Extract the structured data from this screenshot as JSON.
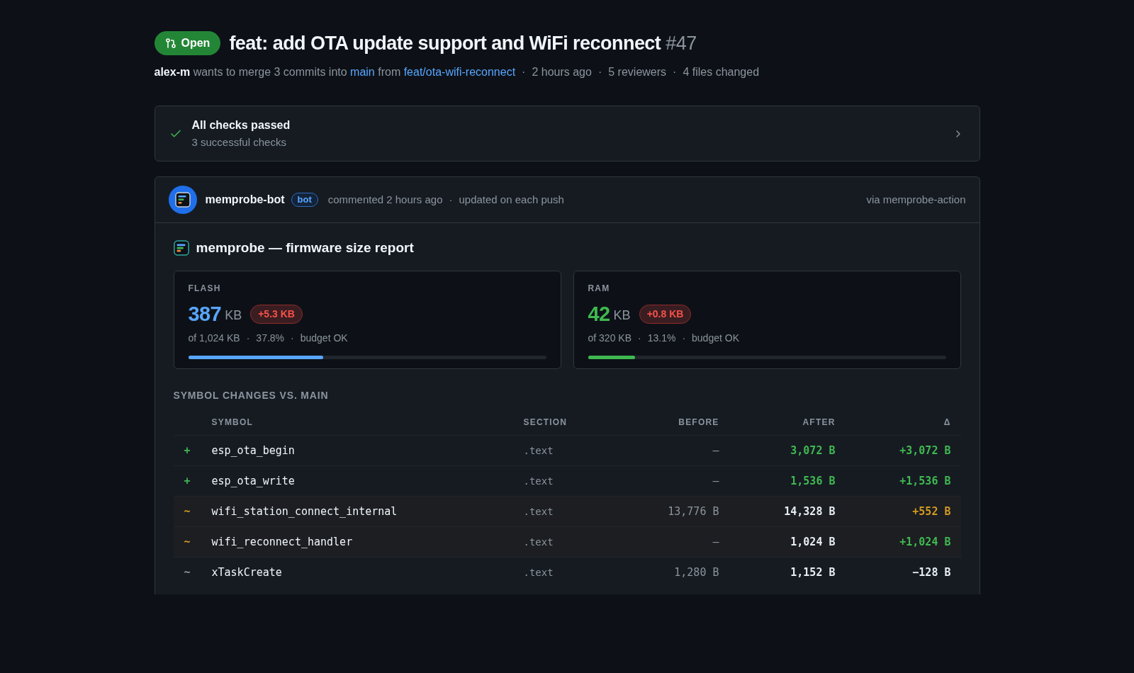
{
  "pull_request": {
    "state": {
      "label": "Open",
      "kind": "open"
    },
    "title": "feat: add OTA update support and WiFi reconnect",
    "number": "#47"
  },
  "summary": {
    "author": "alex-m",
    "action": "wants to merge 3 commits into",
    "base_branch": "main",
    "joiner": "from",
    "head_branch": "feat/ota-wifi-reconnect",
    "separator": "·",
    "meta": [
      "2 hours ago",
      "5 reviewers",
      "4 files changed"
    ]
  },
  "checks": {
    "passed": true,
    "title": "All checks passed",
    "subtitle": "3 successful checks"
  },
  "comment": {
    "author": "memprobe-bot",
    "badge": "bot",
    "action": "commented 2 hours ago",
    "separator": "·",
    "note": "updated on each push",
    "source": "via memprobe-action",
    "report": {
      "title": "memprobe — firmware size report",
      "cards": [
        {
          "label": "FLASH",
          "value": "387",
          "unit": "KB",
          "delta": "+5.3 KB",
          "separator": "·",
          "details": [
            "of 1,024 KB",
            "37.8%",
            "budget OK"
          ],
          "level": 0.378,
          "color": "#58a6ff"
        },
        {
          "label": "RAM",
          "value": "42",
          "unit": "KB",
          "delta": "+0.8 KB",
          "separator": "·",
          "details": [
            "of 320 KB",
            "13.1%",
            "budget OK"
          ],
          "level": 0.131,
          "color": "#3fb950"
        }
      ],
      "symbols": {
        "title": "SYMBOL CHANGES VS. MAIN",
        "columns": [
          "SYMBOL",
          "SECTION",
          "BEFORE",
          "AFTER",
          "Δ"
        ],
        "rows": [
          {
            "marker": "+",
            "kind": "added",
            "symbol": "esp_ota_begin",
            "section": ".text",
            "before": "—",
            "after": {
              "text": "3,072 B",
              "kind": "positive"
            },
            "delta": {
              "text": "+3,072 B",
              "kind": "positive"
            }
          },
          {
            "marker": "+",
            "kind": "added",
            "symbol": "esp_ota_write",
            "section": ".text",
            "before": "—",
            "after": {
              "text": "1,536 B",
              "kind": "positive"
            },
            "delta": {
              "text": "+1,536 B",
              "kind": "positive"
            }
          },
          {
            "marker": "~",
            "kind": "changed",
            "symbol": "wifi_station_connect_internal",
            "section": ".text",
            "before": "13,776 B",
            "after": {
              "text": "14,328 B",
              "kind": "neutral"
            },
            "delta": {
              "text": "+552 B",
              "kind": "warning"
            }
          },
          {
            "marker": "~",
            "kind": "changed",
            "symbol": "wifi_reconnect_handler",
            "section": ".text",
            "before": "—",
            "after": {
              "text": "1,024 B",
              "kind": "neutral"
            },
            "delta": {
              "text": "+1,024 B",
              "kind": "positive"
            }
          },
          {
            "marker": "~",
            "kind": "minor",
            "symbol": "xTaskCreate",
            "section": ".text",
            "before": "1,280 B",
            "after": {
              "text": "1,152 B",
              "kind": "neutral"
            },
            "delta": {
              "text": "−128 B",
              "kind": "neutral"
            }
          }
        ]
      }
    }
  }
}
